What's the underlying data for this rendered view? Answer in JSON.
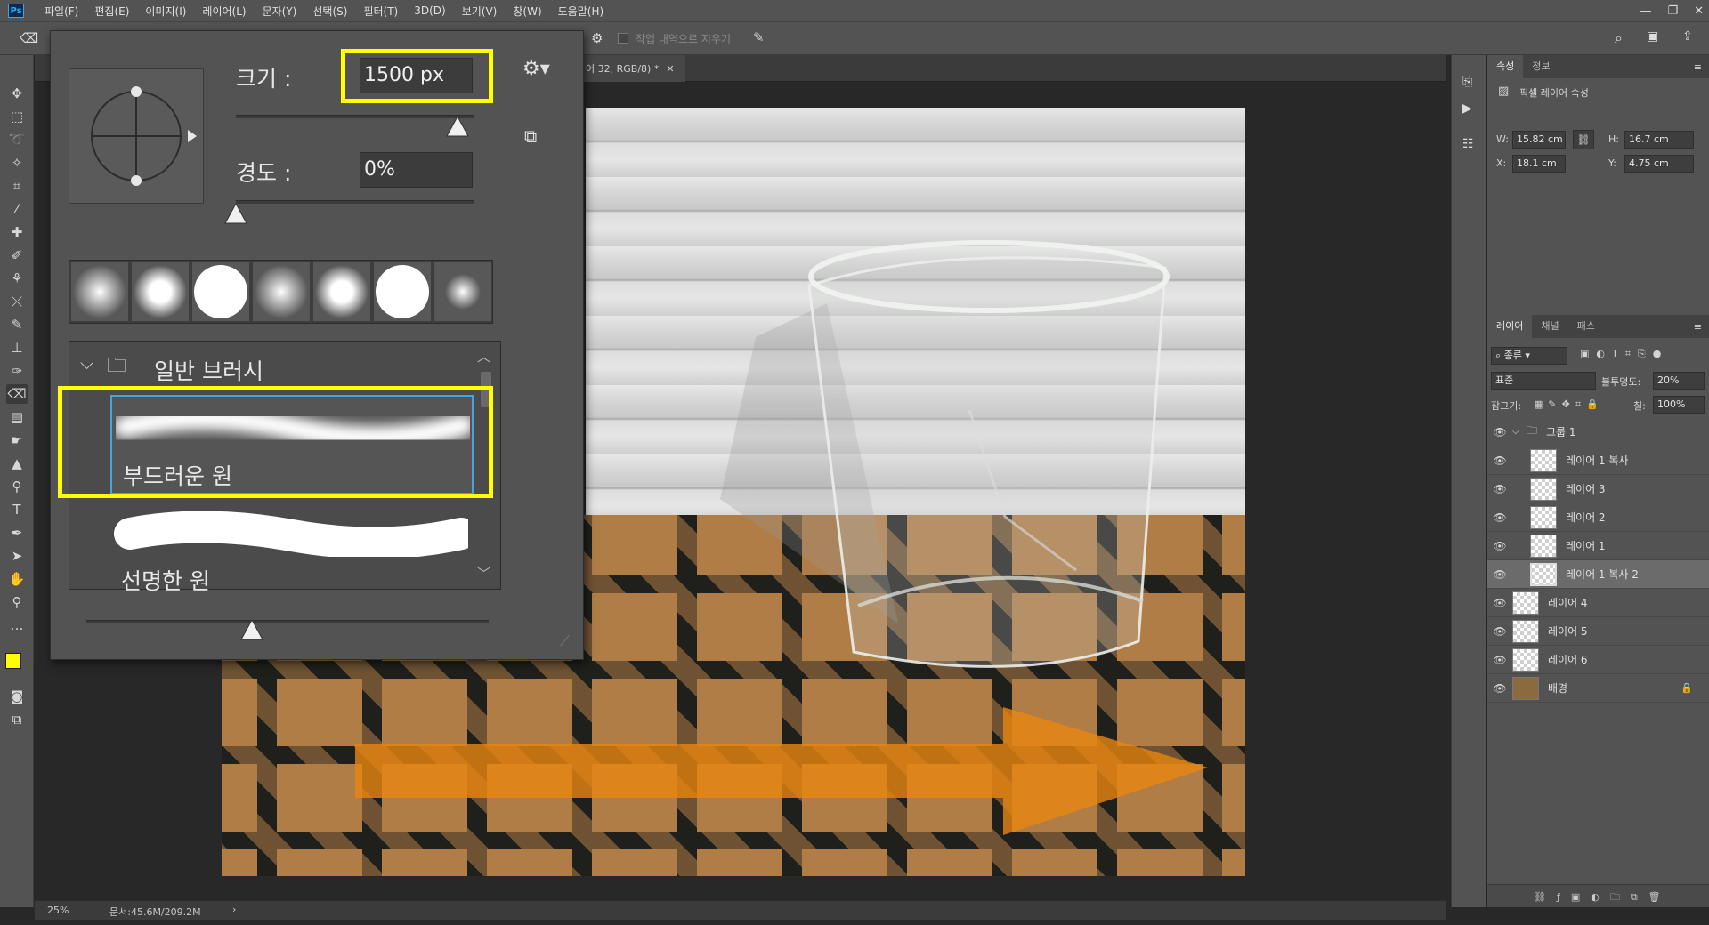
{
  "menu": {
    "items": [
      "파일(F)",
      "편집(E)",
      "이미지(I)",
      "레이어(L)",
      "문자(Y)",
      "선택(S)",
      "필터(T)",
      "3D(D)",
      "보기(V)",
      "창(W)",
      "도움말(H)"
    ],
    "app_logo": "Ps"
  },
  "options_bar": {
    "erase_history_label": "작업 내역으로 지우기"
  },
  "document": {
    "tab_title": "어 32, RGB/8) *",
    "zoom": "25%",
    "doc_size": "문서:45.6M/209.2M"
  },
  "brush_panel": {
    "size_label": "크기 :",
    "size_value": "1500 px",
    "size_slider_fraction": 0.93,
    "hardness_label": "경도 :",
    "hardness_value": "0%",
    "hardness_slider_fraction": 0.0,
    "group_name": "일반 브러시",
    "brushes": [
      {
        "name": "부드러운 원",
        "selected": true
      },
      {
        "name": "선명한 원",
        "selected": false
      }
    ]
  },
  "properties": {
    "tabs": [
      "속성",
      "정보"
    ],
    "title": "픽셀 레이어 속성",
    "w_label": "W:",
    "w_value": "15.82 cm",
    "h_label": "H:",
    "h_value": "16.7 cm",
    "x_label": "X:",
    "x_value": "18.1 cm",
    "y_label": "Y:",
    "y_value": "4.75 cm"
  },
  "layers": {
    "tabs": [
      "레이어",
      "채널",
      "패스"
    ],
    "filter_label": "종류",
    "blend_mode": "표준",
    "opacity_label": "불투명도:",
    "opacity_value": "20%",
    "lock_label": "잠그기:",
    "fill_label": "칠:",
    "fill_value": "100%",
    "items": [
      {
        "name": "그룹 1",
        "type": "group"
      },
      {
        "name": "레이어 1 복사",
        "type": "layer"
      },
      {
        "name": "레이어 3",
        "type": "layer"
      },
      {
        "name": "레이어 2",
        "type": "layer"
      },
      {
        "name": "레이어 1",
        "type": "layer"
      },
      {
        "name": "레이어 1 복사 2",
        "type": "layer",
        "selected": true
      },
      {
        "name": "레이어 4",
        "type": "layer"
      },
      {
        "name": "레이어 5",
        "type": "layer"
      },
      {
        "name": "레이어 6",
        "type": "layer"
      },
      {
        "name": "배경",
        "type": "background",
        "locked": true
      }
    ]
  },
  "colors": {
    "foreground": "#ffff00",
    "background": "#0033cc",
    "highlight": "#ffff00",
    "arrow": "#e8860f"
  }
}
